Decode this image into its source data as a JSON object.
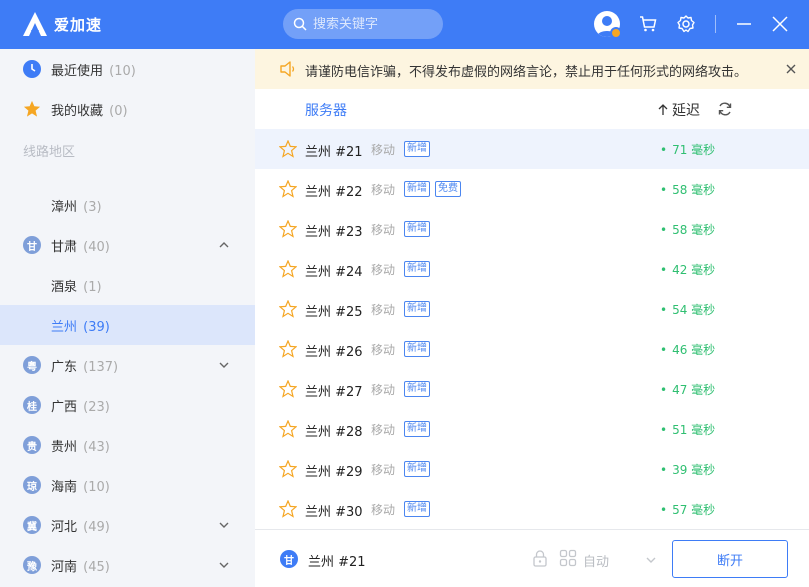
{
  "app": {
    "name": "爱加速"
  },
  "search": {
    "placeholder": "搜索关键字"
  },
  "sidebar": {
    "recent": {
      "label": "最近使用",
      "count": "(10)"
    },
    "favorites": {
      "label": "我的收藏",
      "count": "(0)"
    },
    "section_label": "线路地区",
    "items": [
      {
        "label": "漳州",
        "count": "(3)",
        "level": "child"
      },
      {
        "label": "甘肃",
        "count": "(40)",
        "level": "province",
        "badge": "甘",
        "expanded": true
      },
      {
        "label": "酒泉",
        "count": "(1)",
        "level": "child"
      },
      {
        "label": "兰州",
        "count": "(39)",
        "level": "child",
        "selected": true
      },
      {
        "label": "广东",
        "count": "(137)",
        "level": "province",
        "badge": "粤",
        "expanded": false
      },
      {
        "label": "广西",
        "count": "(23)",
        "level": "province",
        "badge": "桂"
      },
      {
        "label": "贵州",
        "count": "(43)",
        "level": "province",
        "badge": "贵"
      },
      {
        "label": "海南",
        "count": "(10)",
        "level": "province",
        "badge": "琼"
      },
      {
        "label": "河北",
        "count": "(49)",
        "level": "province",
        "badge": "冀",
        "expanded": false
      },
      {
        "label": "河南",
        "count": "(45)",
        "level": "province",
        "badge": "豫",
        "expanded": false
      }
    ]
  },
  "notice": {
    "text": "请谨防电信诈骗，不得发布虚假的网络言论，禁止用于任何形式的网络攻击。"
  },
  "columns": {
    "server": "服务器",
    "delay": "延迟"
  },
  "servers": [
    {
      "name": "兰州 #21",
      "isp": "移动",
      "tags": [
        "新增"
      ],
      "latency": "71 毫秒"
    },
    {
      "name": "兰州 #22",
      "isp": "移动",
      "tags": [
        "新增",
        "免费"
      ],
      "latency": "58 毫秒"
    },
    {
      "name": "兰州 #23",
      "isp": "移动",
      "tags": [
        "新增"
      ],
      "latency": "58 毫秒"
    },
    {
      "name": "兰州 #24",
      "isp": "移动",
      "tags": [
        "新增"
      ],
      "latency": "42 毫秒"
    },
    {
      "name": "兰州 #25",
      "isp": "移动",
      "tags": [
        "新增"
      ],
      "latency": "54 毫秒"
    },
    {
      "name": "兰州 #26",
      "isp": "移动",
      "tags": [
        "新增"
      ],
      "latency": "46 毫秒"
    },
    {
      "name": "兰州 #27",
      "isp": "移动",
      "tags": [
        "新增"
      ],
      "latency": "47 毫秒"
    },
    {
      "name": "兰州 #28",
      "isp": "移动",
      "tags": [
        "新增"
      ],
      "latency": "51 毫秒"
    },
    {
      "name": "兰州 #29",
      "isp": "移动",
      "tags": [
        "新增"
      ],
      "latency": "39 毫秒"
    },
    {
      "name": "兰州 #30",
      "isp": "移动",
      "tags": [
        "新增"
      ],
      "latency": "57 毫秒"
    }
  ],
  "bottom": {
    "current_badge": "甘",
    "current_name": "兰州 #21",
    "mode": "自动",
    "disconnect": "断开"
  },
  "colors": {
    "brand": "#3e7cf6",
    "latency": "#2fbf71",
    "notice_bg": "#fdf5e0",
    "star": "#f5a623"
  }
}
